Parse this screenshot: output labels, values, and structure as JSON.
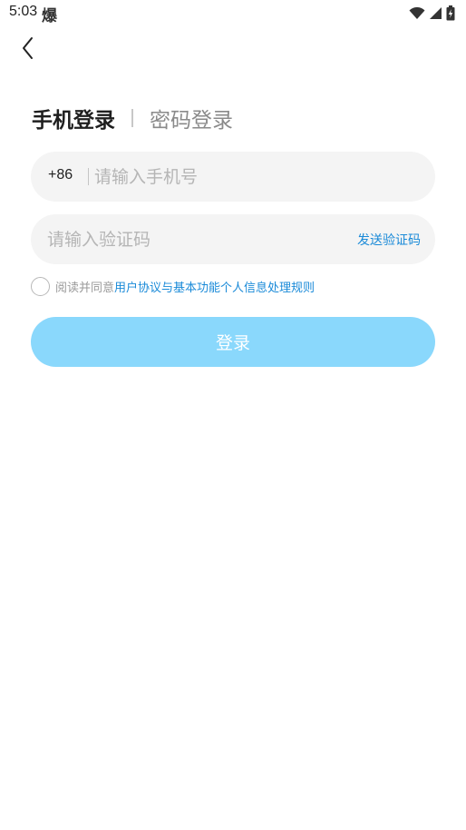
{
  "status_bar": {
    "time": "5:03",
    "app_icon_char": "爆",
    "icons": [
      "wifi-icon",
      "signal-icon",
      "battery-charging-icon"
    ]
  },
  "nav": {
    "back_icon": "chevron-left-icon"
  },
  "tabs": {
    "active": "手机登录",
    "inactive": "密码登录"
  },
  "phone_field": {
    "country_code": "+86",
    "placeholder": "请输入手机号",
    "value": ""
  },
  "code_field": {
    "placeholder": "请输入验证码",
    "value": "",
    "send_label": "发送验证码"
  },
  "agreement": {
    "checked": false,
    "prefix": "阅读并同意",
    "links": [
      "用户协议",
      "与",
      "基本功能个人信息处理规则"
    ]
  },
  "login_button": {
    "label": "登录"
  },
  "colors": {
    "accent_blue": "#1a8ad8",
    "button_bg": "#8ad8fc",
    "field_bg": "#f4f4f4"
  }
}
